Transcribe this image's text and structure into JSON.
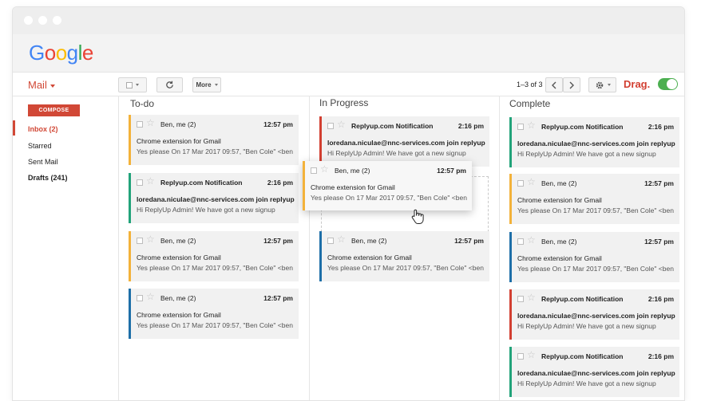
{
  "logo": {
    "letters": [
      "G",
      "o",
      "o",
      "g",
      "l",
      "e"
    ],
    "colors": [
      "#4285F4",
      "#EA4335",
      "#FBBC05",
      "#4285F4",
      "#34A853",
      "#EA4335"
    ]
  },
  "toolbar": {
    "mail_label": "Mail",
    "more_label": "More",
    "page_count": "1–3 of 3",
    "drag_label": "Drag."
  },
  "sidebar": {
    "compose": "COMPOSE",
    "items": [
      "Inbox (2)",
      "Starred",
      "Sent Mail",
      "Drafts (241)"
    ]
  },
  "columns": [
    {
      "title": "To-do"
    },
    {
      "title": "In Progress"
    },
    {
      "title": "Complete"
    }
  ],
  "accent_colors": {
    "orange": "#f3b23a",
    "green": "#22a37a",
    "blue": "#1e6fa8",
    "red": "#d23f31"
  },
  "cards": {
    "todo": [
      {
        "sender": "Ben, me (2)",
        "time": "12:57 pm",
        "subject": "Chrome extension for Gmail",
        "snippet": "Yes please On 17 Mar 2017 09:57, \"Ben Cole\" <ben"
      },
      {
        "sender": "Replyup.com Notification",
        "time": "2:16 pm",
        "subject": "loredana.niculae@nnc-services.com join replyup",
        "snippet": "Hi ReplyUp Admin! We have got a new signup"
      },
      {
        "sender": "Ben, me (2)",
        "time": "12:57 pm",
        "subject": "Chrome extension for Gmail",
        "snippet": "Yes please On 17 Mar 2017 09:57, \"Ben Cole\" <ben"
      },
      {
        "sender": "Ben, me (2)",
        "time": "12:57 pm",
        "subject": "Chrome extension for Gmail",
        "snippet": "Yes please On 17 Mar 2017 09:57, \"Ben Cole\" <ben"
      }
    ],
    "progress": [
      {
        "sender": "Replyup.com Notification",
        "time": "2:16 pm",
        "subject": "loredana.niculae@nnc-services.com join replyup",
        "snippet": "Hi ReplyUp Admin! We have got a new signup"
      },
      {
        "sender": "Ben, me (2)",
        "time": "12:57 pm",
        "subject": "Chrome extension for Gmail",
        "snippet": "Yes please On 17 Mar 2017 09:57, \"Ben Cole\" <ben"
      }
    ],
    "dragging": {
      "sender": "Ben, me (2)",
      "time": "12:57 pm",
      "subject": "Chrome extension for Gmail",
      "snippet": "Yes please On 17 Mar 2017 09:57, \"Ben Cole\" <ben"
    },
    "complete": [
      {
        "sender": "Replyup.com Notification",
        "time": "2:16 pm",
        "subject": "loredana.niculae@nnc-services.com join replyup",
        "snippet": "Hi ReplyUp Admin! We have got a new signup"
      },
      {
        "sender": "Ben, me (2)",
        "time": "12:57 pm",
        "subject": "Chrome extension for Gmail",
        "snippet": "Yes please On 17 Mar 2017 09:57, \"Ben Cole\" <ben"
      },
      {
        "sender": "Ben, me (2)",
        "time": "12:57 pm",
        "subject": "Chrome extension for Gmail",
        "snippet": "Yes please On 17 Mar 2017 09:57, \"Ben Cole\" <ben"
      },
      {
        "sender": "Replyup.com Notification",
        "time": "2:16 pm",
        "subject": "loredana.niculae@nnc-services.com join replyup",
        "snippet": "Hi ReplyUp Admin! We have got a new signup"
      },
      {
        "sender": "Replyup.com Notification",
        "time": "2:16 pm",
        "subject": "loredana.niculae@nnc-services.com join replyup",
        "snippet": "Hi ReplyUp Admin! We have got a new signup"
      }
    ]
  }
}
